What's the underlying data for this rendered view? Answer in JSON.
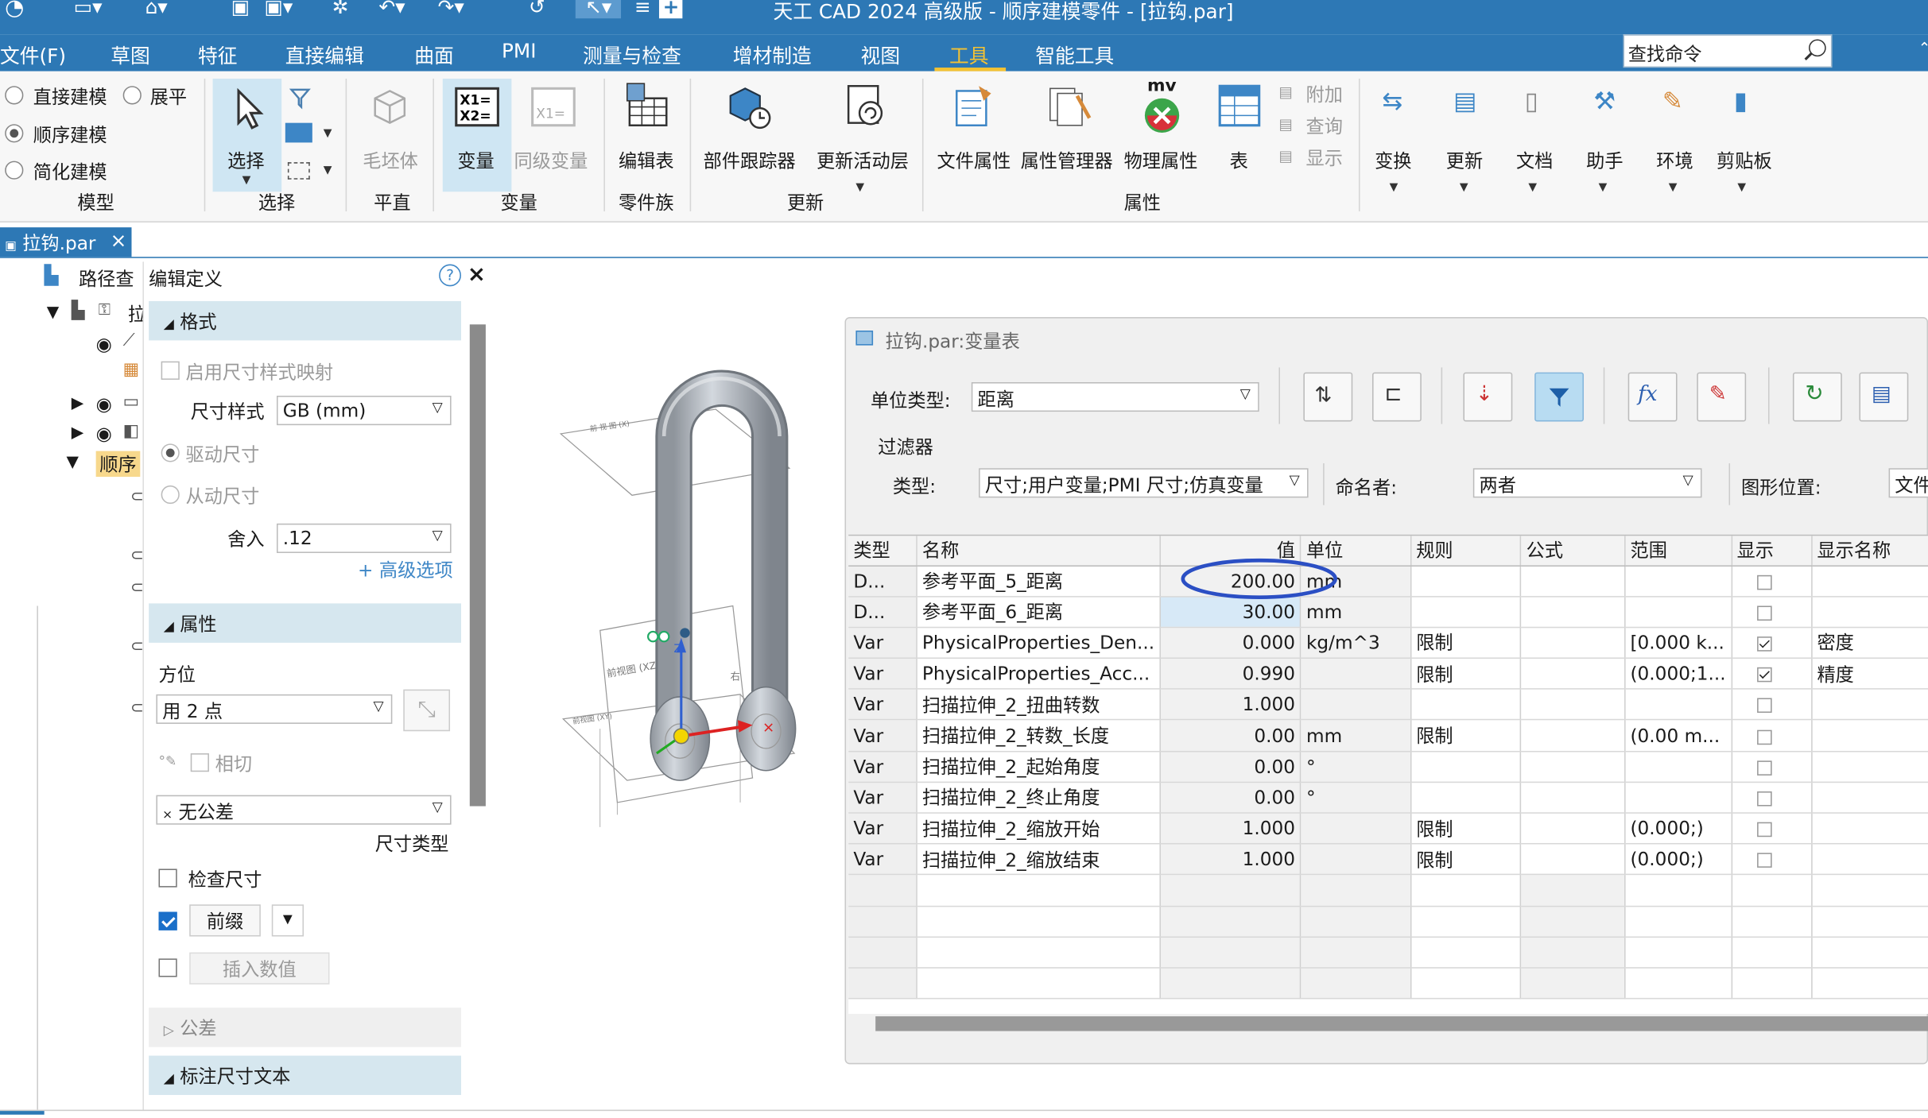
{
  "window": {
    "title": "天工 CAD 2024 高级版 - 顺序建模零件 - [拉钩.par]"
  },
  "menu": {
    "items": [
      "文件(F)",
      "草图",
      "特征",
      "直接编辑",
      "曲面",
      "PMI",
      "测量与检查",
      "增材制造",
      "视图",
      "工具",
      "智能工具"
    ],
    "active": "工具",
    "search_placeholder": "查找命令"
  },
  "ribbon": {
    "model": {
      "direct": "直接建模",
      "flatten": "展平",
      "sequential": "顺序建模",
      "simplified": "简化建模",
      "group": "模型"
    },
    "select": {
      "label": "选择",
      "group": "选择"
    },
    "plane": {
      "blank": "毛坯体",
      "group": "平直"
    },
    "variable": {
      "var": "变量",
      "peer": "同级变量",
      "group": "变量"
    },
    "family": {
      "edit_table": "编辑表",
      "group": "零件族"
    },
    "update": {
      "tracker": "部件跟踪器",
      "active_layer": "更新活动层",
      "group": "更新"
    },
    "props": {
      "file": "文件属性",
      "manager": "属性管理器",
      "physical": "物理属性",
      "table": "表",
      "attach": "附加",
      "query": "查询",
      "display": "显示",
      "group": "属性",
      "mv": "mv"
    },
    "others": {
      "transform": "变换",
      "update": "更新",
      "doc": "文档",
      "assistant": "助手",
      "env": "环境",
      "clipboard": "剪贴板"
    }
  },
  "doc_tab": {
    "label": "拉钩.par",
    "close": "×"
  },
  "tree": {
    "pathfinder": "路径查",
    "item_label": "顺序",
    "item_partial": "拉"
  },
  "panel": {
    "title": "编辑定义",
    "help": "?",
    "close": "×",
    "format": {
      "header": "格式",
      "enable_map": "启用尺寸样式映射",
      "style_label": "尺寸样式",
      "style_value": "GB (mm)",
      "driving": "驱动尺寸",
      "driven": "从动尺寸",
      "round_label": "舍入",
      "round_value": ".12",
      "advanced": "+ 高级选项"
    },
    "attrs": {
      "header": "属性",
      "orientation_label": "方位",
      "orientation_value": "用 2 点",
      "tangent": "相切",
      "tolerance_value": "无公差",
      "tolerance_prefix": "×",
      "dim_type": "尺寸类型",
      "check_dim": "检查尺寸",
      "prefix": "前缀",
      "insert_value": "插入数值"
    },
    "tolerance_header": "公差",
    "annotation_header": "标注尺寸文本"
  },
  "dialog": {
    "title": "拉钩.par:变量表",
    "unit_type_label": "单位类型:",
    "unit_type_value": "距离",
    "filter_label": "过滤器",
    "type_label": "类型:",
    "type_value": "尺寸;用户变量;PMI 尺寸;仿真变量",
    "namer_label": "命名者:",
    "namer_value": "两者",
    "graphic_pos_label": "图形位置:",
    "graphic_pos_value": "文件",
    "fx": "fx",
    "columns": [
      "类型",
      "名称",
      "值",
      "单位",
      "规则",
      "公式",
      "范围",
      "显示",
      "显示名称"
    ],
    "rows": [
      {
        "type": "D...",
        "name": "参考平面_5_距离",
        "value": "200.00",
        "unit": "mm",
        "rule": "",
        "formula": "",
        "range": "",
        "show": false,
        "display": ""
      },
      {
        "type": "D...",
        "name": "参考平面_6_距离",
        "value": "30.00",
        "unit": "mm",
        "rule": "",
        "formula": "",
        "range": "",
        "show": false,
        "display": ""
      },
      {
        "type": "Var",
        "name": "PhysicalProperties_Den...",
        "value": "0.000",
        "unit": "kg/m^3",
        "rule": "限制",
        "formula": "",
        "range": "[0.000 k...",
        "show": true,
        "display": "密度"
      },
      {
        "type": "Var",
        "name": "PhysicalProperties_Acc...",
        "value": "0.990",
        "unit": "",
        "rule": "限制",
        "formula": "",
        "range": "(0.000;1...",
        "show": true,
        "display": "精度"
      },
      {
        "type": "Var",
        "name": "扫描拉伸_2_扭曲转数",
        "value": "1.000",
        "unit": "",
        "rule": "",
        "formula": "",
        "range": "",
        "show": false,
        "display": ""
      },
      {
        "type": "Var",
        "name": "扫描拉伸_2_转数_长度",
        "value": "0.00",
        "unit": "mm",
        "rule": "限制",
        "formula": "",
        "range": "(0.00 m...",
        "show": false,
        "display": ""
      },
      {
        "type": "Var",
        "name": "扫描拉伸_2_起始角度",
        "value": "0.00",
        "unit": "°",
        "rule": "",
        "formula": "",
        "range": "",
        "show": false,
        "display": ""
      },
      {
        "type": "Var",
        "name": "扫描拉伸_2_终止角度",
        "value": "0.00",
        "unit": "°",
        "rule": "",
        "formula": "",
        "range": "",
        "show": false,
        "display": ""
      },
      {
        "type": "Var",
        "name": "扫描拉伸_2_缩放开始",
        "value": "1.000",
        "unit": "",
        "rule": "限制",
        "formula": "",
        "range": "(0.000;)",
        "show": false,
        "display": ""
      },
      {
        "type": "Var",
        "name": "扫描拉伸_2_缩放结束",
        "value": "1.000",
        "unit": "",
        "rule": "限制",
        "formula": "",
        "range": "(0.000;)",
        "show": false,
        "display": ""
      }
    ]
  },
  "viewport": {
    "plane_front": "前视图 (XZ)",
    "plane_right": "右",
    "plane_top": "前视图 (XY)",
    "axis_z": "Z"
  },
  "colors": {
    "accent": "#2d78b5",
    "active_tab": "#f4c233",
    "highlight_ellipse": "#2b4fc4"
  }
}
